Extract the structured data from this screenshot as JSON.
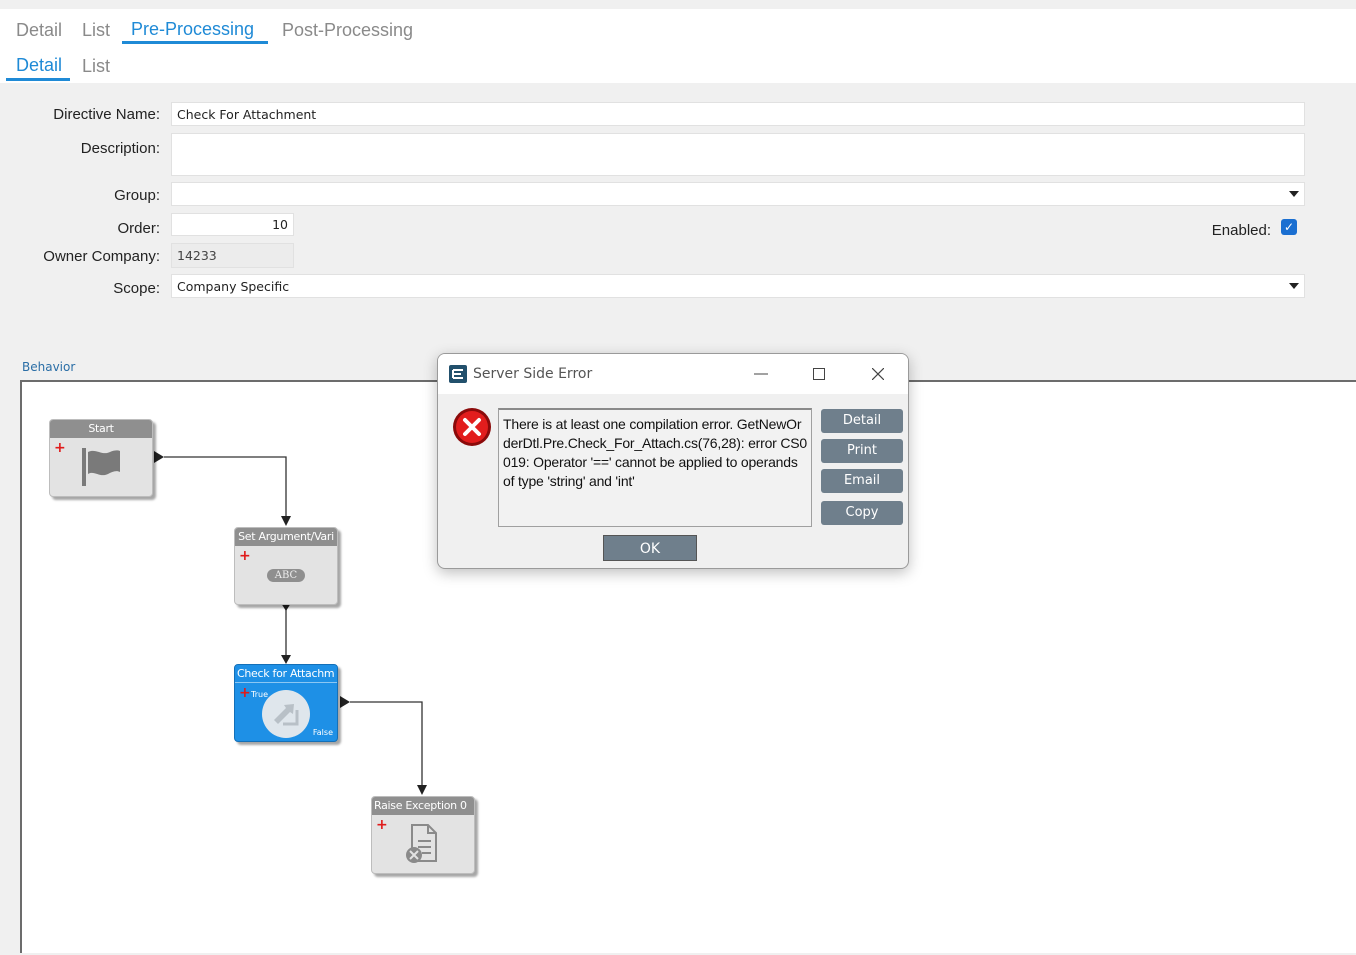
{
  "tabs": {
    "primary": [
      "Detail",
      "List",
      "Pre-Processing",
      "Post-Processing"
    ],
    "secondary": [
      "Detail",
      "List"
    ]
  },
  "form": {
    "directive_name_label": "Directive Name:",
    "directive_name": "Check For Attachment",
    "description_label": "Description:",
    "description": "",
    "group_label": "Group:",
    "group": "",
    "order_label": "Order:",
    "order": "10",
    "owner_company_label": "Owner Company:",
    "owner_company": "14233",
    "scope_label": "Scope:",
    "scope": "Company Specific",
    "enabled_label": "Enabled:",
    "enabled_check": "✓"
  },
  "behavior": {
    "label": "Behavior",
    "nodes": {
      "start": "Start",
      "set_argument": "Set Argument/Vari",
      "set_argument_badge": "ABC",
      "check": "Check for Attachm",
      "check_true": "True",
      "check_false": "False",
      "raise": "Raise Exception 0"
    }
  },
  "dialog": {
    "title": "Server Side Error",
    "message": "There is at least one compilation error. GetNewOrderDtl.Pre.Check_For_Attach.cs(76,28): error CS0019: Operator '==' cannot be applied to operands of type 'string' and 'int'",
    "buttons": {
      "detail": "Detail",
      "print": "Print",
      "email": "Email",
      "copy": "Copy"
    },
    "ok": "OK"
  },
  "colors": {
    "accent": "#1f8ad6",
    "dialog_button": "#6f7f8c",
    "error_red": "#e01b1b",
    "node_blue": "#1e90e6"
  }
}
